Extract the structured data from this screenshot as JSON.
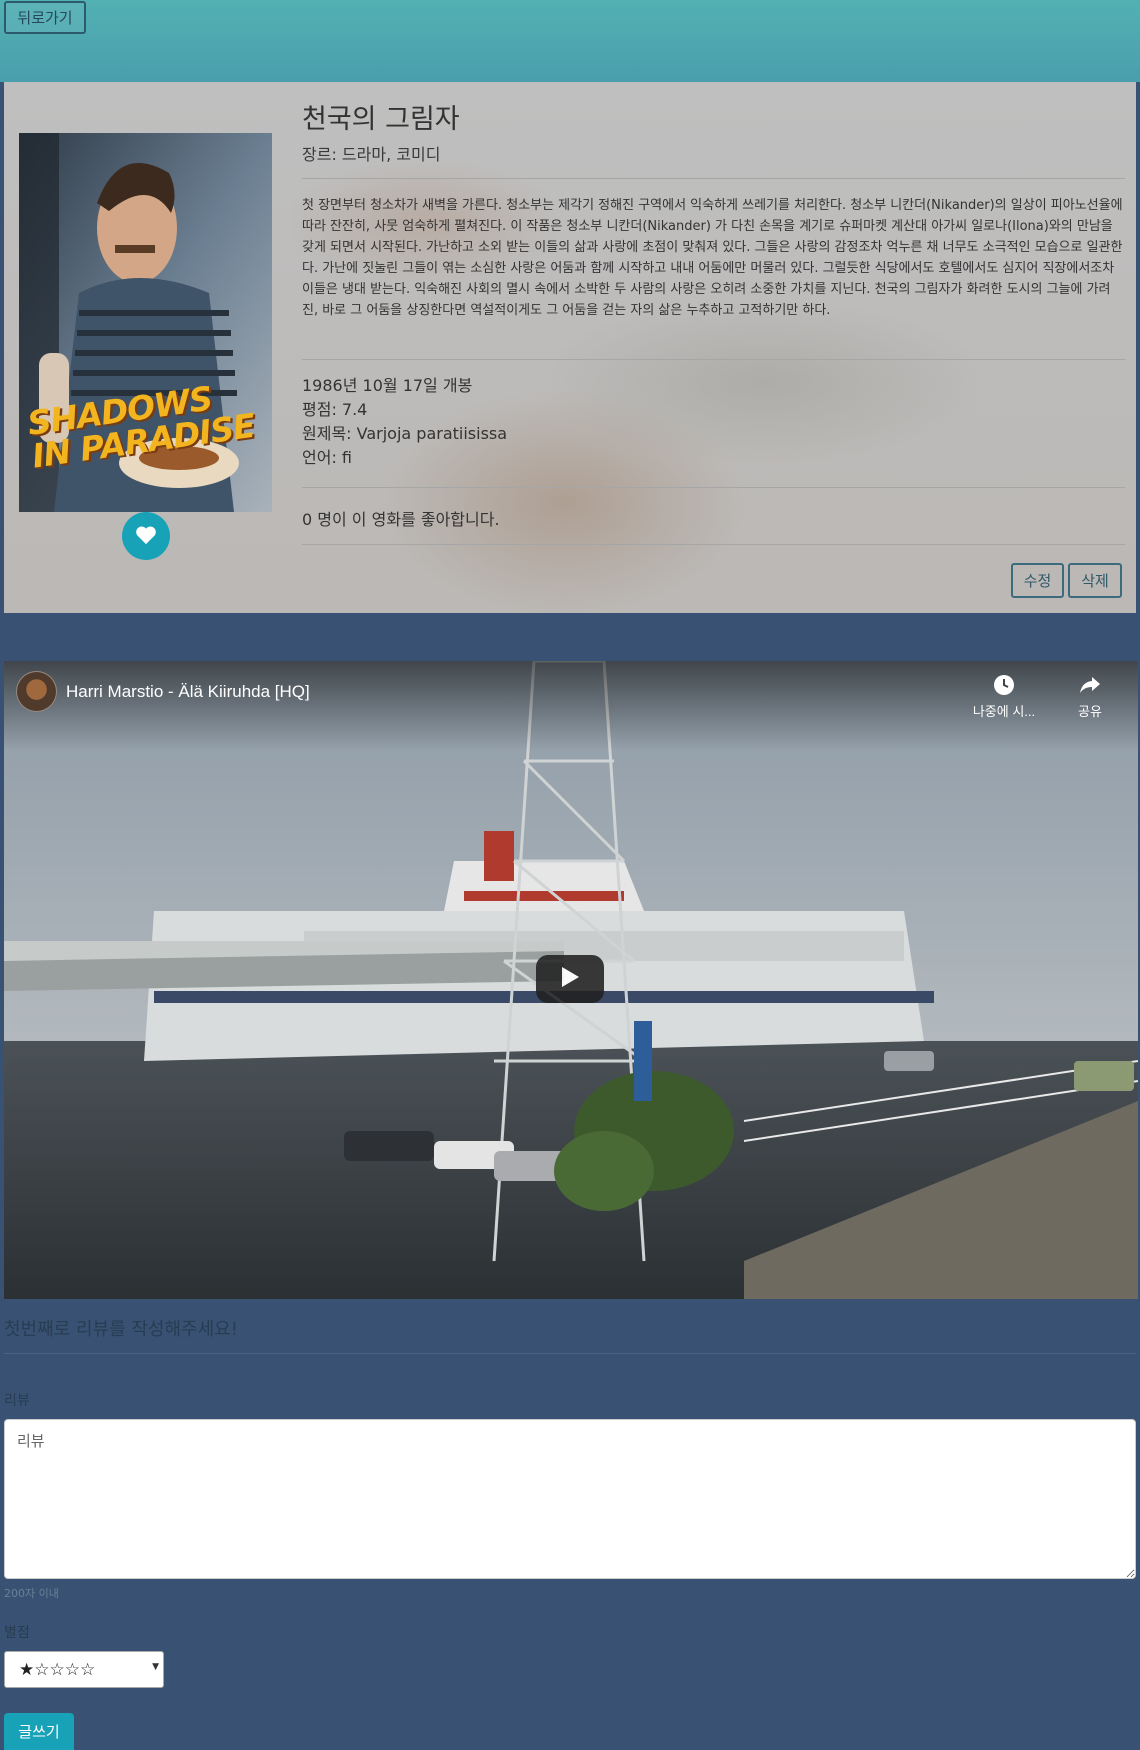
{
  "nav": {
    "back_label": "뒤로가기"
  },
  "movie": {
    "title": "천국의 그림자",
    "genre": "장르: 드라마, 코미디",
    "overview": "첫 장면부터 청소차가 새벽을 가른다. 청소부는 제각기 정해진 구역에서 익숙하게 쓰레기를 처리한다. 청소부 니칸더(Nikander)의 일상이 피아노선율에 따라 잔잔히, 사뭇 엄숙하게 펼쳐진다.  이 작품은 청소부 니칸더(Nikander) 가 다친 손목을 계기로 슈퍼마켓 계산대 아가씨 일로나(Ilona)와의 만남을 갖게 되면서 시작된다. 가난하고 소외 받는 이들의 삶과 사랑에 초점이 맞춰져 있다. 그들은 사랑의 감정조차 억누른 채 너무도 소극적인 모습으로 일관한다. 가난에 짓눌린 그들이 엮는 소심한 사랑은 어둠과 함께 시작하고 내내 어둠에만 머물러 있다. 그럴듯한 식당에서도 호텔에서도 심지어 직장에서조차 이들은 냉대 받는다. 익숙해진 사회의 멸시 속에서 소박한 두 사람의 사랑은 오히려 소중한 가치를 지닌다. 천국의 그림자가 화려한 도시의 그늘에 가려진, 바로 그 어둠을 상징한다면 역설적이게도 그 어둠을 걷는 자의 삶은 누추하고 고적하기만 하다.",
    "release": "1986년 10월 17일 개봉",
    "rating": "평점: 7.4",
    "original_title": "원제목: Varjoja paratiisissa",
    "language": "언어: fi",
    "likes": "0 명이 이 영화를 좋아합니다.",
    "poster_title": "SHADOWS IN PARADISE",
    "edit_label": "수정",
    "delete_label": "삭제"
  },
  "video": {
    "title": "Harri Marstio - Älä Kiiruhda [HQ]",
    "watch_later": "나중에 시...",
    "share": "공유"
  },
  "review_form": {
    "heading": "첫번째로 리뷰를 작성해주세요!",
    "label": "리뷰",
    "placeholder": "리뷰",
    "hint": "200자 이내",
    "rating_label": "별점",
    "rating_value": "★☆☆☆☆",
    "submit_label": "글쓰기"
  },
  "colors": {
    "accent": "#17a2b8",
    "page_bg": "#395273",
    "header_band": "#52b1b3"
  },
  "icons": {
    "like": "heart-icon",
    "watch_later": "clock-icon",
    "share": "share-arrow-icon",
    "play": "play-icon"
  }
}
